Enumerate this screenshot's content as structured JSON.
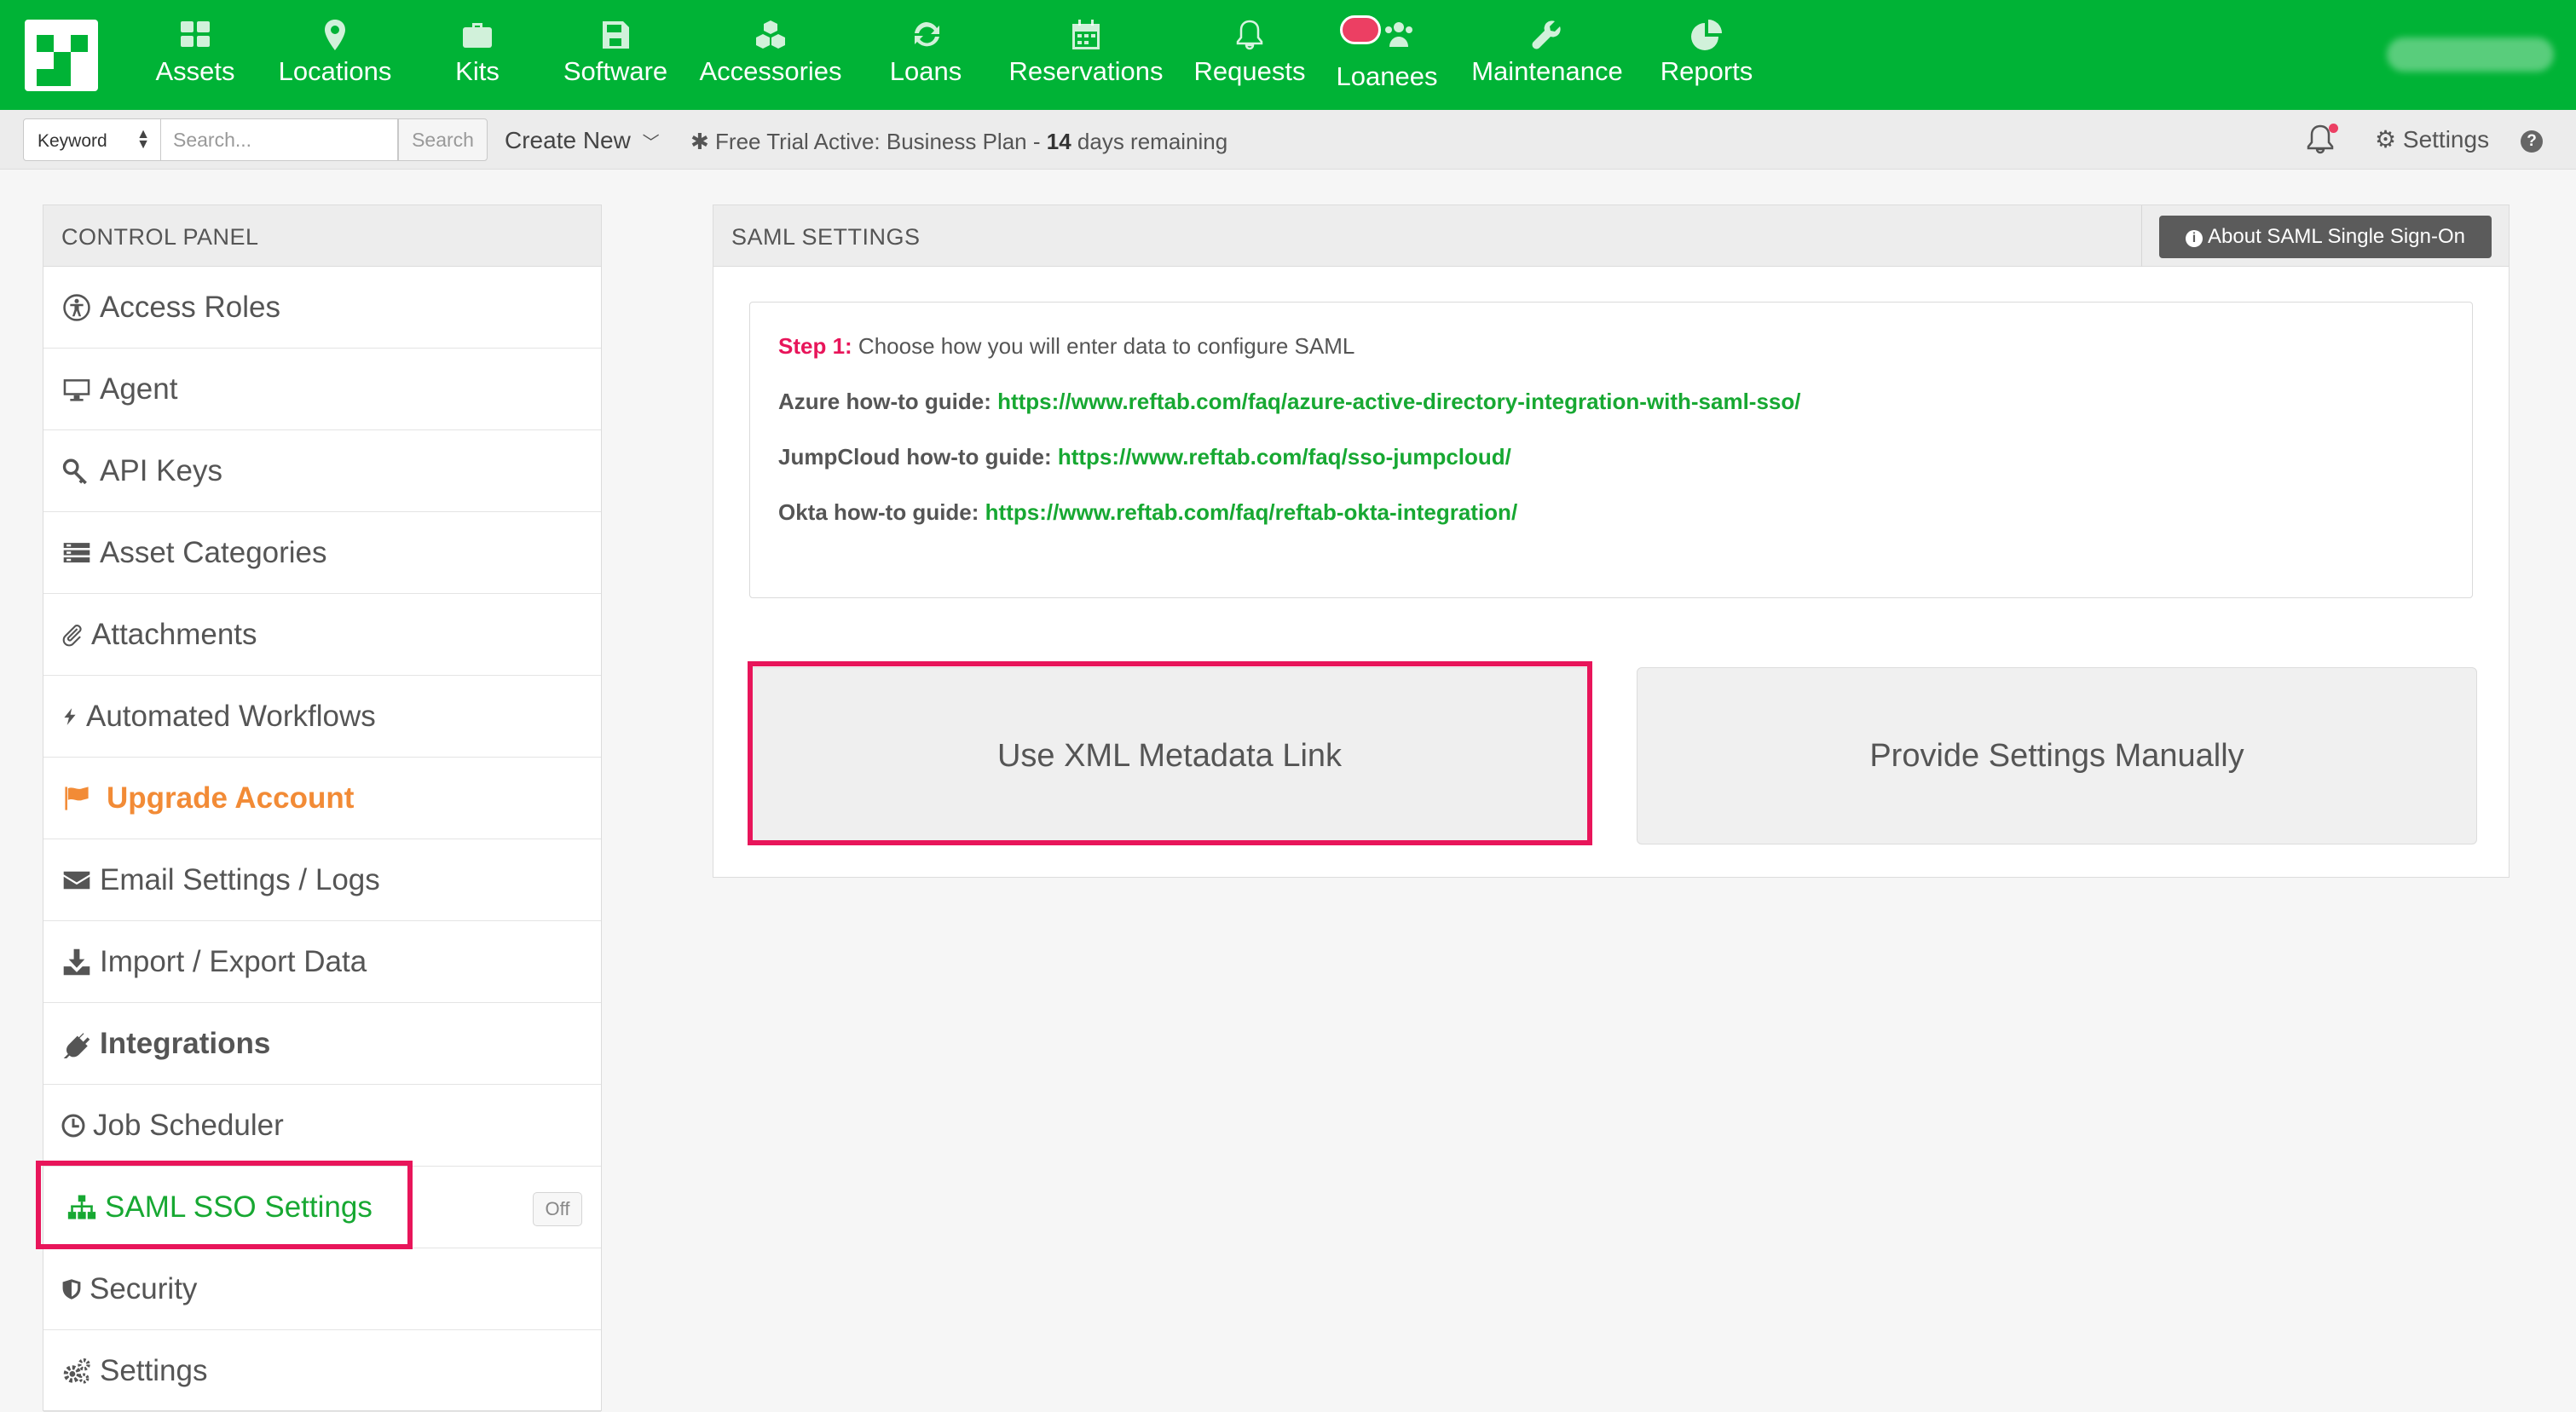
{
  "topnav": {
    "items": [
      {
        "label": "Assets",
        "icon": "grid-icon"
      },
      {
        "label": "Locations",
        "icon": "map-marker-icon"
      },
      {
        "label": "Kits",
        "icon": "briefcase-icon"
      },
      {
        "label": "Software",
        "icon": "floppy-disk-icon"
      },
      {
        "label": "Accessories",
        "icon": "cubes-icon"
      },
      {
        "label": "Loans",
        "icon": "refresh-icon"
      },
      {
        "label": "Reservations",
        "icon": "calendar-icon"
      },
      {
        "label": "Requests",
        "icon": "bell-icon"
      },
      {
        "label": "Loanees",
        "icon": "users-icon"
      },
      {
        "label": "Maintenance",
        "icon": "wrench-icon"
      },
      {
        "label": "Reports",
        "icon": "pie-chart-icon"
      }
    ]
  },
  "subbar": {
    "keyword_label": "Keyword",
    "search_placeholder": "Search...",
    "search_button": "Search",
    "create_new": "Create New",
    "trial_prefix": "Free Trial Active: Business Plan - ",
    "trial_days": "14",
    "trial_suffix": " days remaining",
    "settings_label": "Settings",
    "help_label": "?"
  },
  "sidebar": {
    "title": "CONTROL PANEL",
    "items": [
      {
        "label": "Access Roles",
        "icon": "universal-access-icon"
      },
      {
        "label": "Agent",
        "icon": "monitor-icon"
      },
      {
        "label": "API Keys",
        "icon": "key-icon"
      },
      {
        "label": "Asset Categories",
        "icon": "list-icon"
      },
      {
        "label": "Attachments",
        "icon": "paperclip-icon"
      },
      {
        "label": "Automated Workflows",
        "icon": "bolt-icon"
      },
      {
        "label": "Upgrade Account",
        "icon": "flag-icon"
      },
      {
        "label": "Email Settings / Logs",
        "icon": "envelope-icon"
      },
      {
        "label": "Import / Export Data",
        "icon": "download-icon"
      },
      {
        "label": "Integrations",
        "icon": "plug-icon"
      },
      {
        "label": "Job Scheduler",
        "icon": "clock-icon"
      },
      {
        "label": "SAML SSO Settings",
        "icon": "sitemap-icon",
        "badge": "Off"
      },
      {
        "label": "Security",
        "icon": "shield-icon"
      },
      {
        "label": "Settings",
        "icon": "gears-icon"
      }
    ]
  },
  "panel": {
    "title": "SAML SETTINGS",
    "about_button": "About SAML Single Sign-On",
    "step_label": "Step 1:",
    "step_text": " Choose how you will enter data to configure SAML",
    "guides": [
      {
        "label": "Azure how-to guide:",
        "url": "https://www.reftab.com/faq/azure-active-directory-integration-with-saml-sso/"
      },
      {
        "label": "JumpCloud how-to guide:",
        "url": "https://www.reftab.com/faq/sso-jumpcloud/"
      },
      {
        "label": "Okta how-to guide:",
        "url": "https://www.reftab.com/faq/reftab-okta-integration/"
      }
    ],
    "option_xml": "Use XML Metadata Link",
    "option_manual": "Provide Settings Manually"
  },
  "colors": {
    "brand_green": "#00b336",
    "link_green": "#17a832",
    "highlight_pink": "#e8155a",
    "upgrade_orange": "#f28b36"
  }
}
